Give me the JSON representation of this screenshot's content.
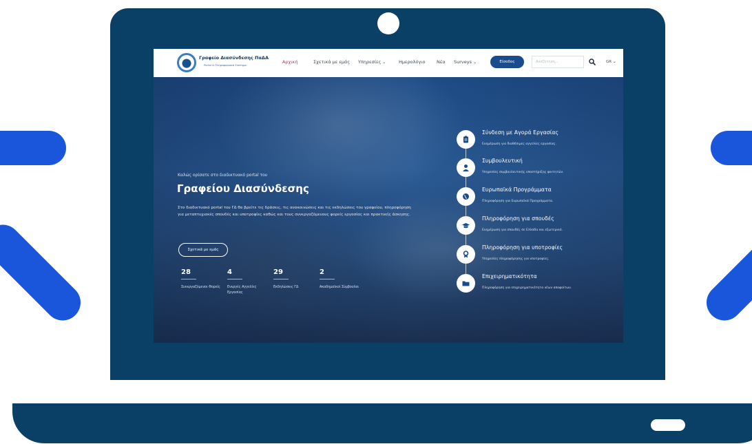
{
  "site": {
    "brand_title": "Γραφείο Διασύνδεσης ΠαΔΑ",
    "brand_subtitle": "Portal & Πληροφοριακό Σύστημα",
    "nav": [
      {
        "label": "Αρχική",
        "icon": ""
      },
      {
        "label": "Σχετικά με εμάς",
        "icon": ""
      },
      {
        "label": "Υπηρεσίες",
        "icon": "chevron-down-icon"
      },
      {
        "label": "Ημερολόγιο",
        "icon": ""
      },
      {
        "label": "Νέα",
        "icon": ""
      },
      {
        "label": "Surveys",
        "icon": "chevron-down-icon"
      }
    ],
    "login_label": "Είσοδος",
    "search_placeholder": "Αναζήτηση...",
    "language": "GR",
    "colors": {
      "accent": "#1a4b8c",
      "active_nav": "#c42f5a",
      "frame": "#0b4066",
      "decor": "#1a56db"
    }
  },
  "hero": {
    "welcome": "Καλώς ορίσατε στο διαδικτυακό portal του",
    "title": "Γραφείου Διασύνδεσης",
    "description": "Στο διαδικτυακό portal του ΓΔ θα βρείτε τις δράσεις, τις ανακοινώσεις και τις εκδηλώσεις του γραφείου, πληροφόρηση για μεταπτυχιακές σπουδές και υποτροφίες καθώς και τους συνεργαζόμενους φορείς εργασίας και πρακτικής άσκησης.",
    "about_button": "Σχετικά με εμάς",
    "stats": [
      {
        "value": "28",
        "label": "Συνεργαζόμενοι Φορείς"
      },
      {
        "value": "4",
        "label": "Ενεργές Αγγελίες Εργασίας"
      },
      {
        "value": "29",
        "label": "Εκδηλώσεις ΓΔ"
      },
      {
        "value": "2",
        "label": "Ακαδημαϊκοί Σύμβουλοι"
      }
    ]
  },
  "services": [
    {
      "title": "Σύνδεση με Αγορά Εργασίας",
      "desc": "Ενημέρωση για διαθέσιμες αγγελίες εργασίας.",
      "icon": "clipboard-icon"
    },
    {
      "title": "Συμβουλευτική",
      "desc": "Υπηρεσίες συμβουλευτικής υποστήριξης φοιτητών.",
      "icon": "user-icon"
    },
    {
      "title": "Ευρωπαϊκά Προγράμματα",
      "desc": "Πληροφόρηση για Ευρωπαϊκά Προγράμματα.",
      "icon": "globe-icon"
    },
    {
      "title": "Πληροφόρηση για σπουδές",
      "desc": "Ενημέρωση για σπουδές σε Ελλάδα και εξωτερικό.",
      "icon": "graduation-cap-icon"
    },
    {
      "title": "Πληροφόρηση για υποτροφίες",
      "desc": "Υπηρεσίες πληροφόρησης για υποτροφίες.",
      "icon": "award-icon"
    },
    {
      "title": "Επιχειρηματικότητα",
      "desc": "Πληροφόρηση για επιχειρηματικότητα νέων αποφοίτων.",
      "icon": "folder-icon"
    }
  ]
}
